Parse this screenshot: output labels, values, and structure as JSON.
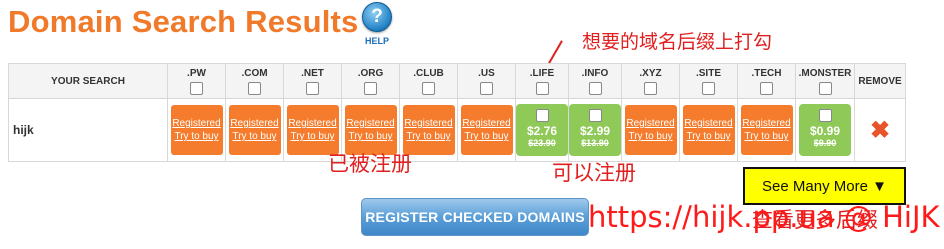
{
  "title": "Domain Search Results",
  "help": {
    "label": "HELP",
    "icon": "question-icon"
  },
  "table": {
    "your_search_header": "YOUR SEARCH",
    "remove_header": "REMOVE",
    "extensions": [
      ".PW",
      ".COM",
      ".NET",
      ".ORG",
      ".CLUB",
      ".US",
      ".LIFE",
      ".INFO",
      ".XYZ",
      ".SITE",
      ".TECH",
      ".MONSTER"
    ],
    "row": {
      "domain": "hijk",
      "cells": [
        {
          "status": "registered",
          "line1": "Registered",
          "line2": "Try to buy"
        },
        {
          "status": "registered",
          "line1": "Registered",
          "line2": "Try to buy"
        },
        {
          "status": "registered",
          "line1": "Registered",
          "line2": "Try to buy"
        },
        {
          "status": "registered",
          "line1": "Registered",
          "line2": "Try to buy"
        },
        {
          "status": "registered",
          "line1": "Registered",
          "line2": "Try to buy"
        },
        {
          "status": "registered",
          "line1": "Registered",
          "line2": "Try to buy"
        },
        {
          "status": "available",
          "price": "$2.76",
          "old_price": "$23.90"
        },
        {
          "status": "available",
          "price": "$2.99",
          "old_price": "$13.90"
        },
        {
          "status": "registered",
          "line1": "Registered",
          "line2": "Try to buy"
        },
        {
          "status": "registered",
          "line1": "Registered",
          "line2": "Try to buy"
        },
        {
          "status": "registered",
          "line1": "Registered",
          "line2": "Try to buy"
        },
        {
          "status": "available",
          "price": "$0.99",
          "old_price": "$9.90"
        }
      ],
      "remove_icon": "close-x-icon"
    }
  },
  "annotations": {
    "want_suffix": "想要的域名后缀上打勾",
    "registered": "已被注册",
    "available": "可以注册",
    "see_more_note": "查看更多后缀"
  },
  "register_button": "REGISTER CHECKED DOMAINS",
  "see_more_button": "See Many More ▼",
  "watermark": "https://hijk.pp.ua @ HiJK",
  "colors": {
    "brand_orange": "#f07a2a",
    "available_green": "#8fc957",
    "annotation_red": "#e02020"
  }
}
